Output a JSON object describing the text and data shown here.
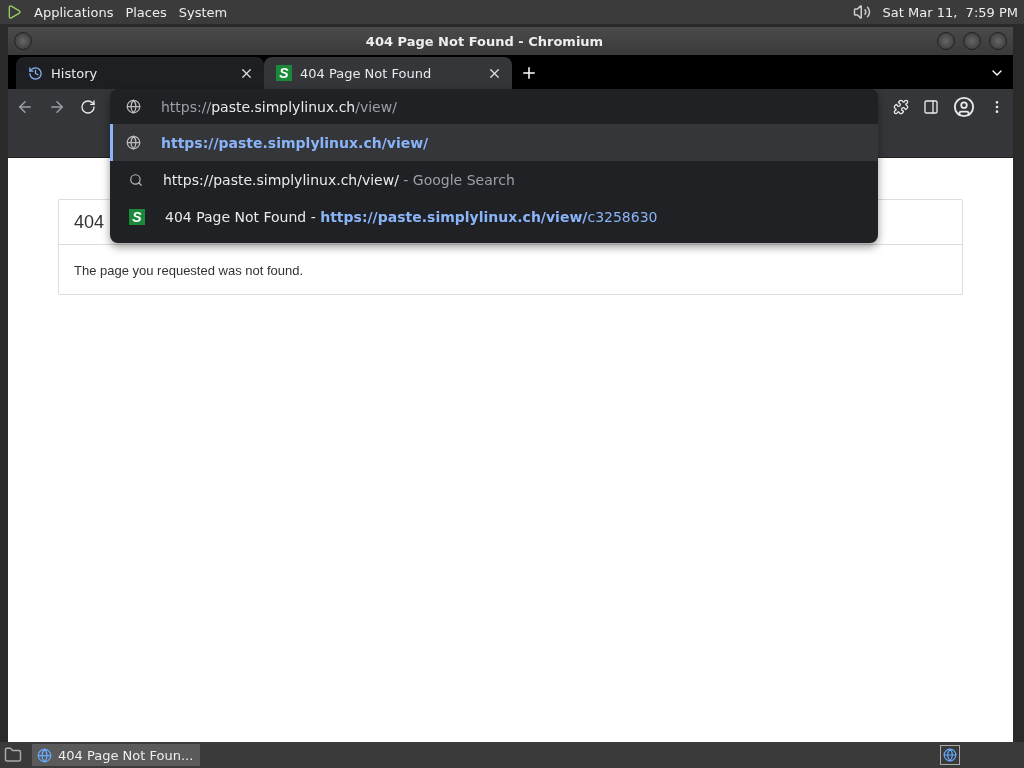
{
  "top_panel": {
    "menus": [
      "Applications",
      "Places",
      "System"
    ],
    "clock": "Sat Mar 11,  7:59 PM"
  },
  "window": {
    "title": "404 Page Not Found - Chromium"
  },
  "tabs": [
    {
      "label": "History",
      "favicon": {
        "kind": "history"
      },
      "selected": false
    },
    {
      "label": "404 Page Not Found",
      "favicon": {
        "kind": "letter",
        "text": "S"
      },
      "selected": true
    }
  ],
  "omnibox": {
    "scheme": "https://",
    "host": "paste.simplylinux.ch",
    "path": "/view/"
  },
  "suggestions": [
    {
      "kind": "url",
      "text": "https://paste.simplylinux.ch/view/",
      "selected": true
    },
    {
      "kind": "search",
      "text": "https://paste.simplylinux.ch/view/",
      "suffix": " - Google Search",
      "selected": false
    },
    {
      "kind": "history",
      "favicon": "S",
      "text": "404 Page Not Found - ",
      "url": "https://paste.simplylinux.ch/view/",
      "tail": "c3258630",
      "selected": false
    }
  ],
  "page": {
    "heading": "404",
    "message": "The page you requested was not found."
  },
  "taskbar": {
    "items": [
      {
        "label": "404 Page Not Foun...",
        "selected": true
      }
    ]
  }
}
